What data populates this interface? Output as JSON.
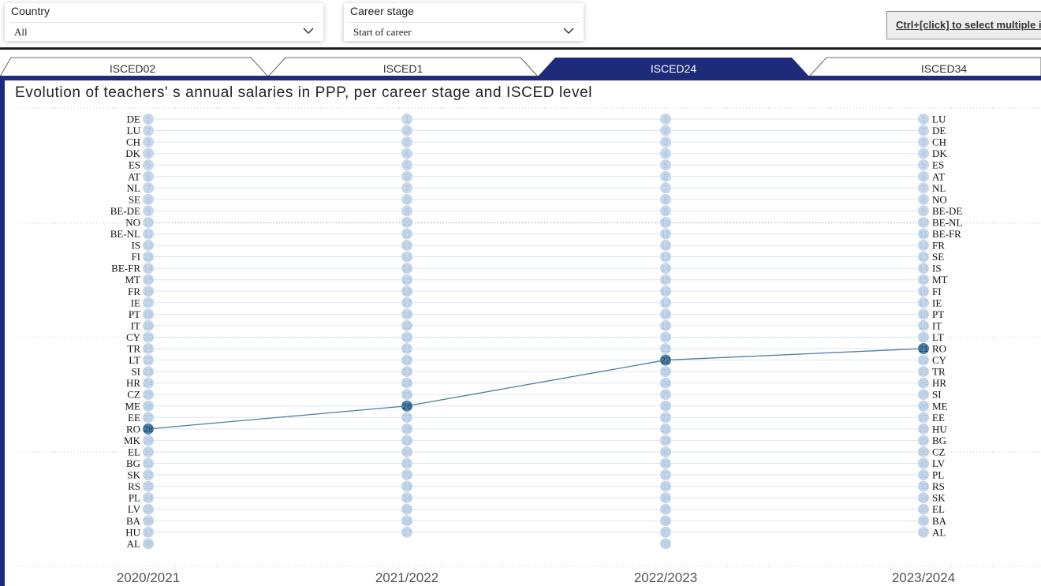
{
  "filters": {
    "country": {
      "label": "Country",
      "value": "All"
    },
    "career": {
      "label": "Career stage",
      "value": "Start of career"
    }
  },
  "hint_button": "Ctrl+[click] to select multiple it",
  "tabs": [
    {
      "label": "ISCED02",
      "active": false
    },
    {
      "label": "ISCED1",
      "active": false
    },
    {
      "label": "ISCED24",
      "active": true
    },
    {
      "label": "ISCED34",
      "active": false
    }
  ],
  "colors": {
    "accent": "#1e2a7a",
    "bubble": "#c7d7ea",
    "bubble_highlight": "#4d82a8",
    "highlight_line": "#4f7b9b",
    "background_line": "#dbe5f1"
  },
  "chart_data": {
    "type": "bump",
    "title": "Evolution of teachers' s annual salaries in PPP, per career stage and ISCED level",
    "years": [
      "2020/2021",
      "2021/2022",
      "2022/2023",
      "2023/2024"
    ],
    "left_labels": [
      "DE",
      "LU",
      "CH",
      "DK",
      "ES",
      "AT",
      "NL",
      "SE",
      "BE-DE",
      "NO",
      "BE-NL",
      "IS",
      "FI",
      "BE-FR",
      "MT",
      "FR",
      "IE",
      "PT",
      "IT",
      "CY",
      "TR",
      "LT",
      "SI",
      "HR",
      "CZ",
      "ME",
      "EE",
      "RO",
      "MK",
      "EL",
      "BG",
      "SK",
      "RS",
      "PL",
      "LV",
      "BA",
      "HU",
      "AL"
    ],
    "right_labels": [
      "LU",
      "DE",
      "CH",
      "DK",
      "ES",
      "AT",
      "NL",
      "NO",
      "BE-DE",
      "BE-NL",
      "BE-FR",
      "FR",
      "SE",
      "IS",
      "MT",
      "FI",
      "IE",
      "PT",
      "IT",
      "LT",
      "RO",
      "CY",
      "TR",
      "HR",
      "SI",
      "ME",
      "EE",
      "HU",
      "BG",
      "CZ",
      "LV",
      "PL",
      "RS",
      "SK",
      "EL",
      "BA",
      "AL"
    ],
    "ranks_per_year": [
      38,
      37,
      38,
      37
    ],
    "highlight": {
      "country": "RO",
      "ranks": [
        28,
        26,
        22,
        21
      ]
    },
    "rank_range": [
      1,
      38
    ]
  }
}
